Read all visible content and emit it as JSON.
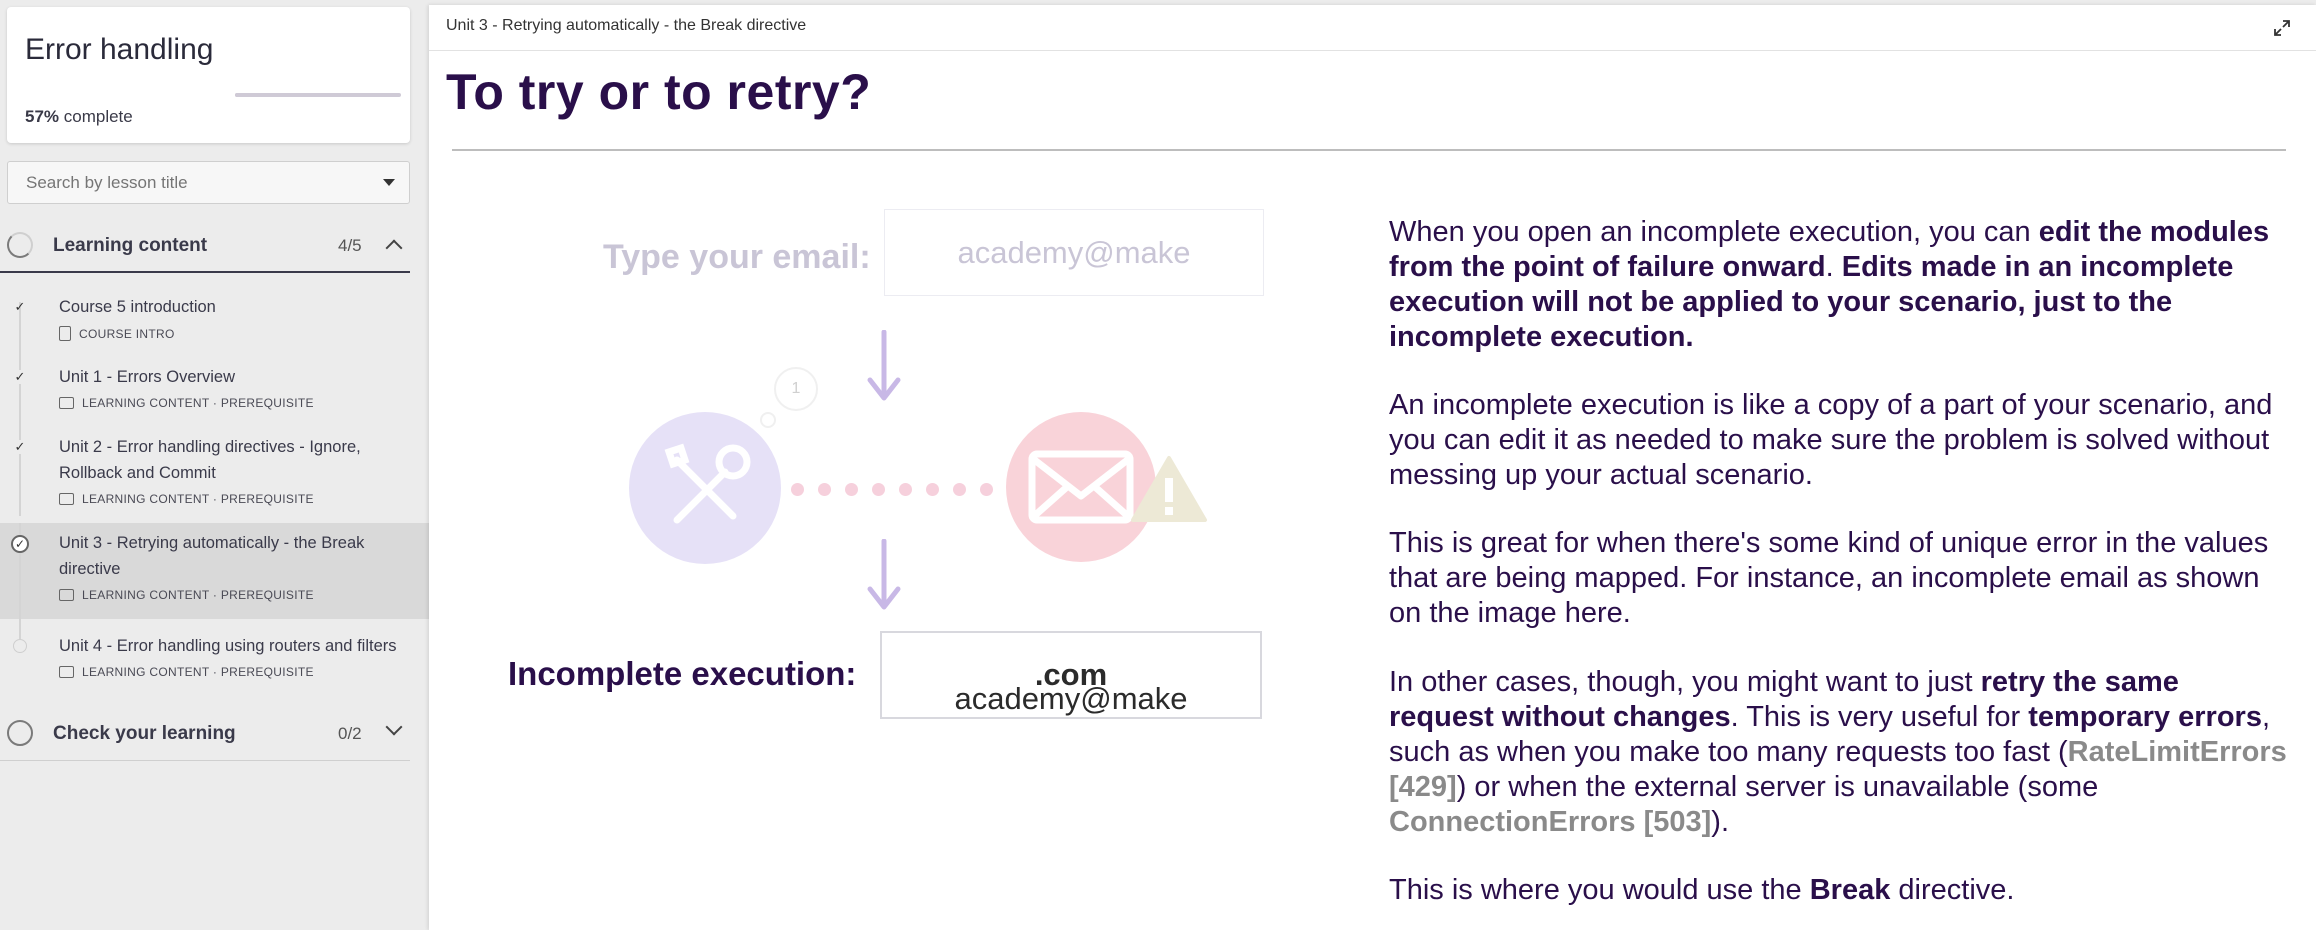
{
  "course": {
    "title": "Error handling",
    "progress_pct": "57%",
    "progress_suffix": " complete",
    "progress_value": 0.57
  },
  "search": {
    "placeholder": "Search by lesson title"
  },
  "sections": [
    {
      "title": "Learning content",
      "count": "4/5",
      "expanded": true
    },
    {
      "title": "Check your learning",
      "count": "0/2",
      "expanded": false
    }
  ],
  "lessons": [
    {
      "title": "Course 5 introduction",
      "meta": "COURSE INTRO",
      "status": "done"
    },
    {
      "title": "Unit 1 - Errors Overview",
      "meta": "LEARNING CONTENT · PREREQUISITE",
      "status": "done"
    },
    {
      "title": "Unit 2 - Error handling directives - Ignore, Rollback and Commit",
      "meta": "LEARNING CONTENT · PREREQUISITE",
      "status": "done"
    },
    {
      "title": "Unit 3 - Retrying automatically - the Break directive",
      "meta": "LEARNING CONTENT · PREREQUISITE",
      "status": "current"
    },
    {
      "title": "Unit 4 - Error handling using routers and filters",
      "meta": "LEARNING CONTENT · PREREQUISITE",
      "status": "todo"
    }
  ],
  "header": {
    "breadcrumb": "Unit 3 - Retrying automatically - the Break directive",
    "expand_icon": "expand-icon"
  },
  "page": {
    "title": "To try or to retry?"
  },
  "illustration": {
    "faded_label": "Type your email:",
    "faded_value": "academy@make",
    "bubble_number": "1",
    "real_label": "Incomplete execution:",
    "real_value_prefix": "academy@make",
    "real_value_suffix": ".com",
    "tool_icon": "tools-icon",
    "mail_icon": "mail-icon",
    "warning_icon": "warning-icon",
    "colors": {
      "tool": "#e6e1f7",
      "mail": "#f9d3d9",
      "warning": "#ede9d6",
      "arrow": "#c8b8e6",
      "dots": "#f6d0dc"
    }
  },
  "body": {
    "p1_a": "When you open an incomplete execution, you can ",
    "p1_b": "edit the modules from the point of failure onward",
    "p1_c": ". ",
    "p1_d": "Edits made in an incomplete execution will not be applied to your scenario, just to the incomplete execution.",
    "p2": "An incomplete execution is like a copy of a part of your scenario, and you can edit it as needed to make sure the problem is solved without messing up your actual scenario.",
    "p3": "This is great for when there's some kind of unique error in the values that are being mapped. For instance, an incomplete email as shown on the image here.",
    "p4_a": "In other cases, though, you might want to just ",
    "p4_b": "retry the same request without changes",
    "p4_c": ". This is very useful for ",
    "p4_d": "temporary errors",
    "p4_e": ", such as when you make too many requests too fast (",
    "p4_f": "RateLimitErrors [429]",
    "p4_g": ") or when the external server is unavailable (some ",
    "p4_h": "ConnectionErrors [503]",
    "p4_i": ").",
    "p5_a": "This is where you would use the ",
    "p5_b": "Break",
    "p5_c": " directive."
  }
}
